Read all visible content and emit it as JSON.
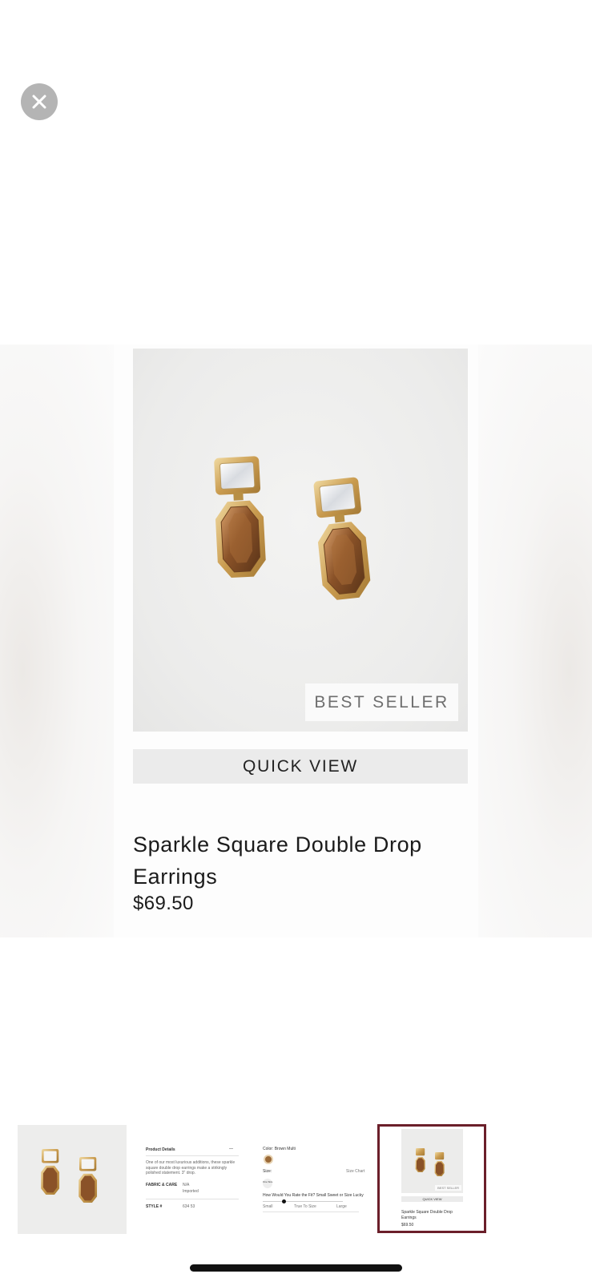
{
  "close": {
    "icon": "close-icon"
  },
  "product": {
    "badge": "BEST SELLER",
    "quick_view_label": "QUICK VIEW",
    "title": "Sparkle Square Double Drop Earrings",
    "price": "$69.50"
  },
  "thumbnails": {
    "details": {
      "heading": "Product Details",
      "toggle": "—",
      "description": "One of our most luxurious additions, these sparkle square double drop earrings make a strikingly polished statement. 3\" drop.",
      "fabric_label": "FABRIC & CARE",
      "fabric_value_1": "N/A",
      "fabric_value_2": "Imported",
      "style_label": "STYLE #",
      "style_value": "634 53"
    },
    "options": {
      "color_label": "Color: Brown Multi",
      "size_label": "Size:",
      "size_chart": "Size Chart",
      "size_option": "One Size",
      "fit_text": "How Would You Rate the Fit? Small Sweet or Size Lucky",
      "fit_small": "Small",
      "fit_true": "True To Size",
      "fit_large": "Large"
    },
    "card": {
      "badge": "BEST SELLER",
      "quick_view": "QUICK VIEW",
      "title": "Sparkle Square Double Drop Earrings",
      "price": "$69.50"
    }
  },
  "colors": {
    "selected_thumb_border": "#6b1f2a",
    "quick_view_bg": "#ebebeb"
  }
}
